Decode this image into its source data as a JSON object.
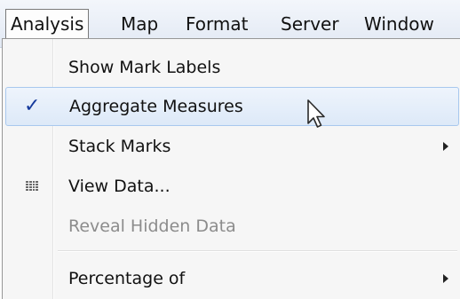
{
  "menubar": {
    "items": [
      {
        "label": "Analysis",
        "active": true
      },
      {
        "label": "Map"
      },
      {
        "label": "Format"
      },
      {
        "label": "Server"
      },
      {
        "label": "Window"
      }
    ]
  },
  "menu": {
    "items": [
      {
        "label": "Show Mark Labels"
      },
      {
        "label": "Aggregate Measures",
        "checked": true,
        "highlighted": true
      },
      {
        "label": "Stack Marks",
        "submenu": true
      },
      {
        "label": "View Data...",
        "icon": "view-data-grid-icon"
      },
      {
        "label": "Reveal Hidden Data",
        "disabled": true
      },
      {
        "label": "Percentage of",
        "submenu": true
      }
    ],
    "check_glyph": "✓"
  },
  "colors": {
    "accent_check": "#153a9c",
    "highlight_border": "#a8c8ee",
    "disabled_text": "#8c8c8c"
  }
}
